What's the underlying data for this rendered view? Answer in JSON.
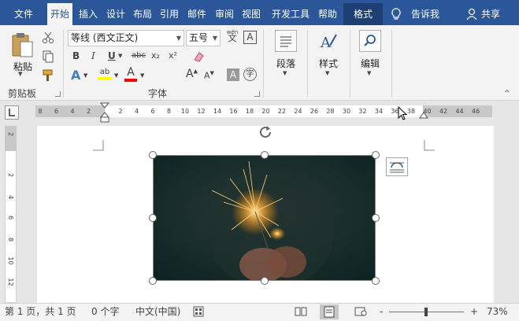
{
  "tabs": [
    {
      "label": "文件"
    },
    {
      "label": "开始"
    },
    {
      "label": "插入"
    },
    {
      "label": "设计"
    },
    {
      "label": "布局"
    },
    {
      "label": "引用"
    },
    {
      "label": "邮件"
    },
    {
      "label": "审阅"
    },
    {
      "label": "视图"
    },
    {
      "label": "开发工具"
    },
    {
      "label": "帮助"
    },
    {
      "label": "格式"
    }
  ],
  "tell_me": "告诉我",
  "share": "共享",
  "clipboard": {
    "paste_label": "粘贴",
    "group_label": "剪贴板"
  },
  "font": {
    "font_name": "等线 (西文正文)",
    "font_size": "五号",
    "wen_label": "wén",
    "wen_char": "文",
    "boxed_char": "A",
    "bold": "B",
    "italic": "I",
    "underline": "U",
    "strike": "abc",
    "subscript": "x₂",
    "superscript": "x²",
    "effects": "A",
    "highlight": "ab",
    "font_color": "A",
    "grow": "A",
    "shrink": "A",
    "shade": "A",
    "enclose": "字",
    "group_label": "字体",
    "colors": {
      "highlight": "#ffff00",
      "font_color": "#ff0000"
    }
  },
  "paragraph": {
    "label": "段落"
  },
  "styles": {
    "label": "样式"
  },
  "editing": {
    "label": "编辑"
  },
  "ruler": {
    "left_numbers": [
      "8",
      "6",
      "4",
      "2"
    ],
    "right_numbers": [
      "2",
      "4",
      "6",
      "8",
      "10",
      "12",
      "14",
      "16",
      "18",
      "20",
      "22",
      "24",
      "26",
      "28",
      "30",
      "32",
      "34",
      "36",
      "38",
      "40",
      "42",
      "44",
      "46"
    ],
    "vertical_numbers": [
      "2",
      "2",
      "4",
      "6",
      "8",
      "10",
      "12"
    ]
  },
  "status": {
    "page": "第 1 页，共 1 页",
    "words": "0 个字",
    "language": "中文(中国)",
    "zoom_minus": "-",
    "zoom_plus": "+",
    "zoom": "73%",
    "zoom_level": 0.49
  }
}
